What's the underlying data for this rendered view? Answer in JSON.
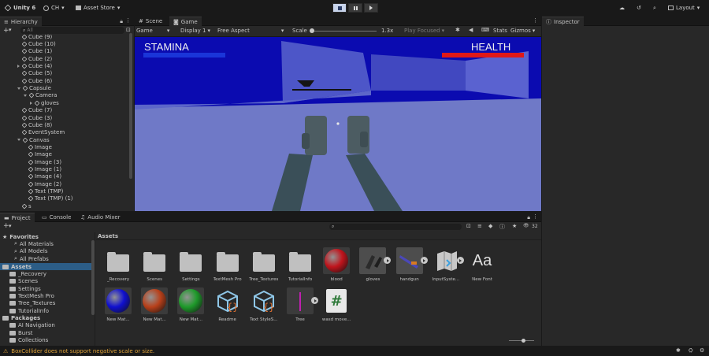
{
  "toolbar": {
    "app_name": "Unity 6",
    "account": "CH",
    "asset_store": "Asset Store",
    "layout": "Layout"
  },
  "hierarchy": {
    "tab": "Hierarchy",
    "search_placeholder": "All",
    "items": [
      {
        "label": "Cube (9)",
        "indent": 1,
        "arrow": ""
      },
      {
        "label": "Cube (10)",
        "indent": 1,
        "arrow": ""
      },
      {
        "label": "Cube (1)",
        "indent": 1,
        "arrow": ""
      },
      {
        "label": "Cube (2)",
        "indent": 1,
        "arrow": ""
      },
      {
        "label": "Cube (4)",
        "indent": 1,
        "arrow": "right"
      },
      {
        "label": "Cube (5)",
        "indent": 1,
        "arrow": ""
      },
      {
        "label": "Cube (6)",
        "indent": 1,
        "arrow": ""
      },
      {
        "label": "Capsule",
        "indent": 1,
        "arrow": "down"
      },
      {
        "label": "Camera",
        "indent": 2,
        "arrow": "down"
      },
      {
        "label": "gloves",
        "indent": 3,
        "arrow": "right"
      },
      {
        "label": "Cube (7)",
        "indent": 1,
        "arrow": ""
      },
      {
        "label": "Cube (3)",
        "indent": 1,
        "arrow": ""
      },
      {
        "label": "Cube (8)",
        "indent": 1,
        "arrow": ""
      },
      {
        "label": "EventSystem",
        "indent": 1,
        "arrow": ""
      },
      {
        "label": "Canvas",
        "indent": 1,
        "arrow": "down"
      },
      {
        "label": "Image",
        "indent": 2,
        "arrow": ""
      },
      {
        "label": "Image",
        "indent": 2,
        "arrow": ""
      },
      {
        "label": "Image (3)",
        "indent": 2,
        "arrow": ""
      },
      {
        "label": "Image (1)",
        "indent": 2,
        "arrow": ""
      },
      {
        "label": "Image (4)",
        "indent": 2,
        "arrow": ""
      },
      {
        "label": "Image (2)",
        "indent": 2,
        "arrow": ""
      },
      {
        "label": "Text (TMP)",
        "indent": 2,
        "arrow": ""
      },
      {
        "label": "Text (TMP) (1)",
        "indent": 2,
        "arrow": ""
      },
      {
        "label": "s",
        "indent": 1,
        "arrow": ""
      }
    ]
  },
  "scene_tabs": {
    "scene": "Scene",
    "game": "Game"
  },
  "game_toolbar": {
    "mode": "Game",
    "display": "Display 1",
    "aspect": "Free Aspect",
    "scale_label": "Scale",
    "scale_value": "1.3x",
    "play_focused": "Play Focused",
    "stats": "Stats",
    "gizmos": "Gizmos"
  },
  "game_view": {
    "stamina_label": "STAMINA",
    "health_label": "HEALTH",
    "colors": {
      "sky": "#0b0bb0",
      "floor": "#6f79c7",
      "stamina_bar": "#1a35d8",
      "health_bar": "#e01818"
    }
  },
  "inspector": {
    "tab": "Inspector"
  },
  "bottom_tabs": {
    "project": "Project",
    "console": "Console",
    "audio_mixer": "Audio Mixer"
  },
  "project": {
    "slider_count": "32",
    "favorites": {
      "label": "Favorites",
      "items": [
        "All Materials",
        "All Models",
        "All Prefabs"
      ]
    },
    "assets_root": {
      "label": "Assets",
      "items": [
        "_Recovery",
        "Scenes",
        "Settings",
        "TextMesh Pro",
        "Tree_Textures",
        "TutorialInfo"
      ]
    },
    "packages_root": {
      "label": "Packages",
      "items": [
        "AI Navigation",
        "Burst",
        "Collections"
      ]
    },
    "breadcrumb": "Assets",
    "assets": [
      {
        "label": "_Recovery",
        "kind": "folder"
      },
      {
        "label": "Scenes",
        "kind": "folder"
      },
      {
        "label": "Settings",
        "kind": "folder"
      },
      {
        "label": "TextMesh Pro",
        "kind": "folder"
      },
      {
        "label": "Tree_Textures",
        "kind": "folder"
      },
      {
        "label": "TutorialInfo",
        "kind": "folder"
      },
      {
        "label": "blood",
        "kind": "material",
        "color": "#c0141c"
      },
      {
        "label": "gloves",
        "kind": "model"
      },
      {
        "label": "handgun",
        "kind": "model"
      },
      {
        "label": "InputSyste...",
        "kind": "input"
      },
      {
        "label": "New Font",
        "kind": "font",
        "glyph": "Aa"
      },
      {
        "label": "New Mat...",
        "kind": "material",
        "color": "#1010d0"
      },
      {
        "label": "New Mat...",
        "kind": "material",
        "color": "#b8401a"
      },
      {
        "label": "New Mat...",
        "kind": "material",
        "color": "#1e9a2a"
      },
      {
        "label": "Readme",
        "kind": "script-obj"
      },
      {
        "label": "Text StyleS...",
        "kind": "script-obj"
      },
      {
        "label": "Tree",
        "kind": "tree"
      },
      {
        "label": "wasd move...",
        "kind": "cs",
        "glyph": "#"
      }
    ]
  },
  "status": {
    "message": "BoxCollider does not support negative scale or size."
  }
}
